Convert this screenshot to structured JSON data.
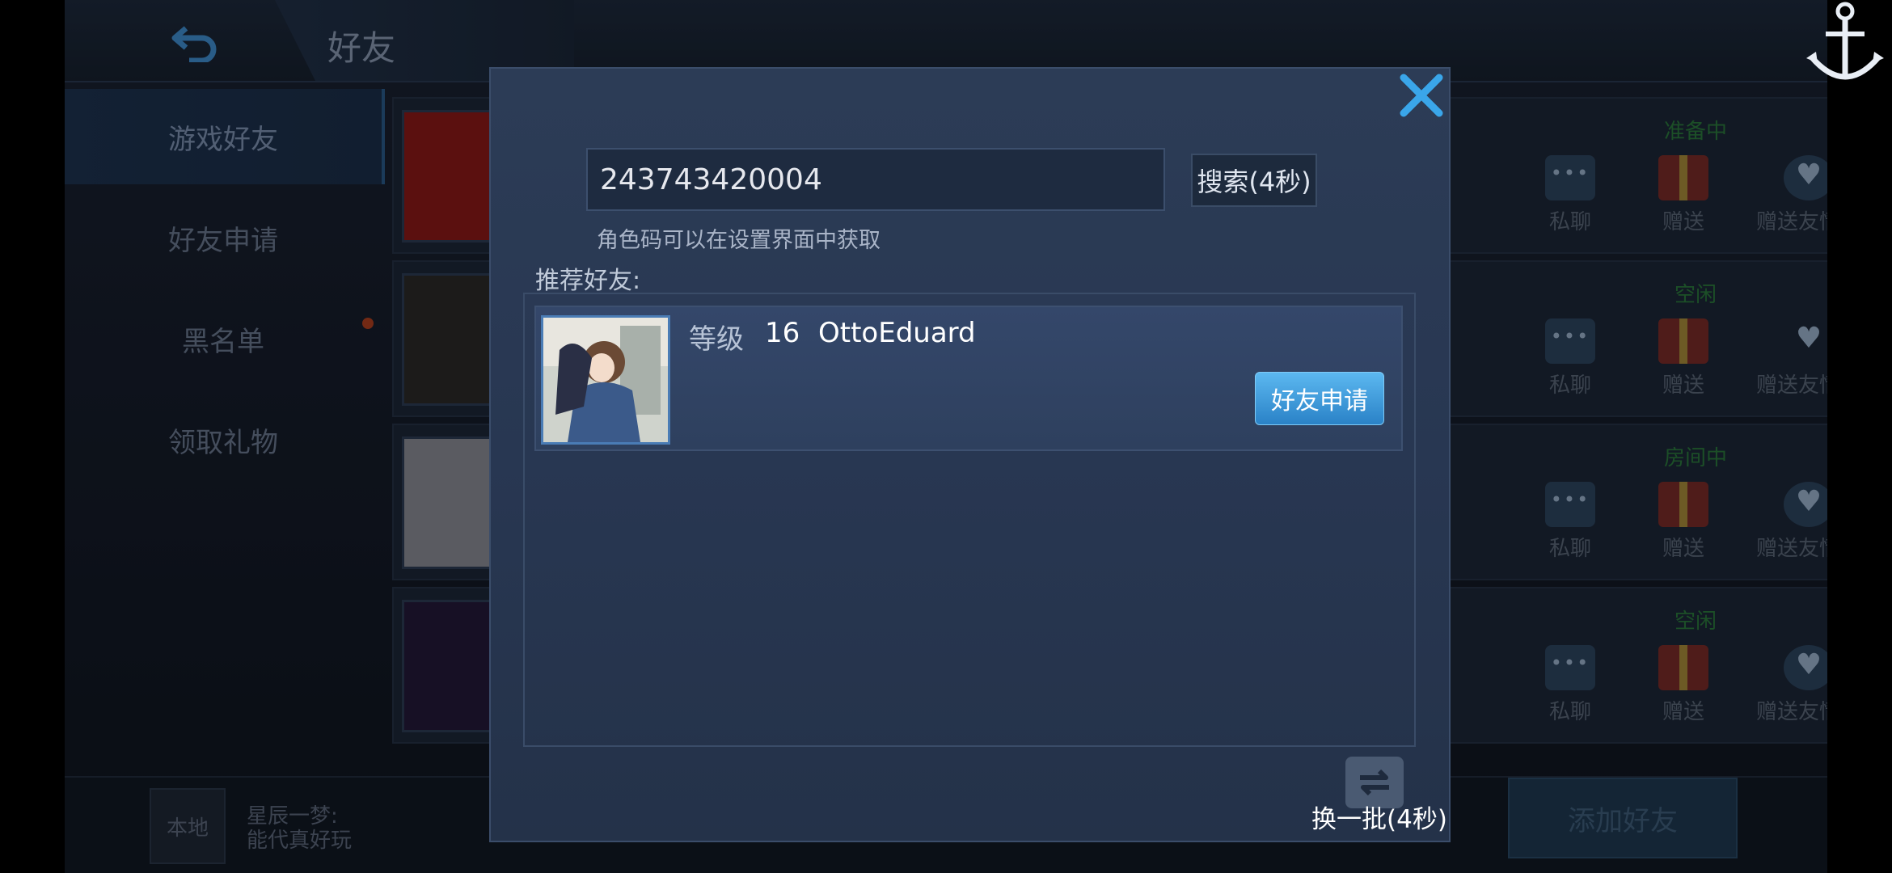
{
  "header": {
    "title": "好友"
  },
  "sidebar": {
    "items": [
      {
        "label": "游戏好友"
      },
      {
        "label": "好友申请"
      },
      {
        "label": "黑名单"
      },
      {
        "label": "领取礼物"
      }
    ]
  },
  "friend_list": {
    "statuses": [
      "准备中",
      "空闲",
      "房间中",
      "空闲"
    ],
    "actions": {
      "chat": "私聊",
      "gift": "赠送",
      "gift_points": "赠送友情点"
    }
  },
  "bottom": {
    "local_tag": "本地",
    "chat_preview_line1": "星辰一梦:",
    "chat_preview_line2": "能代真好玩",
    "add_friend": "添加好友"
  },
  "modal": {
    "search_value": "243743420004",
    "search_button": "搜索(4秒)",
    "hint": "角色码可以在设置界面中获取",
    "recommend_title": "推荐好友:",
    "recommended": [
      {
        "level_label": "等级",
        "level": "16",
        "name": "OttoEduard",
        "apply_label": "好友申请"
      }
    ],
    "refresh_label": "换一批(4秒)"
  },
  "colors": {
    "accent_blue": "#2a82c7",
    "close_blue": "#3aa6ea",
    "status_green": "#2b7a3d"
  }
}
